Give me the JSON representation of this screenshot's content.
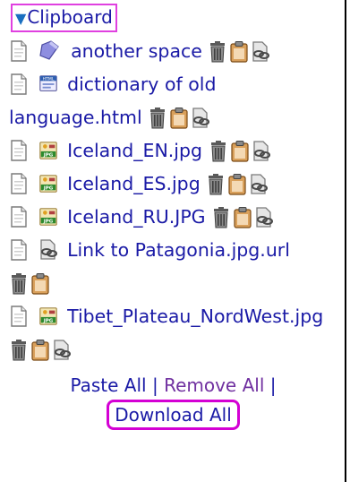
{
  "clipboard": {
    "title": "Clipboard",
    "items": [
      {
        "name": "another space",
        "type": "folder"
      },
      {
        "name": "dictionary of old language.html",
        "type": "html"
      },
      {
        "name": "Iceland_EN.jpg",
        "type": "jpg"
      },
      {
        "name": "Iceland_ES.jpg",
        "type": "jpg"
      },
      {
        "name": "Iceland_RU.JPG",
        "type": "jpg"
      },
      {
        "name": "Link to Patagonia.jpg.url",
        "type": "link"
      },
      {
        "name": "Tibet_Plateau_NordWest.jpg",
        "type": "jpg"
      }
    ],
    "paste_all": "Paste All",
    "separator1": "|",
    "remove_all": "Remove All",
    "separator2": "|",
    "download_all": "Download All"
  },
  "colors": {
    "link": "#1a1aa6",
    "remove_link": "#7030a0",
    "highlight": "#d400d4"
  }
}
